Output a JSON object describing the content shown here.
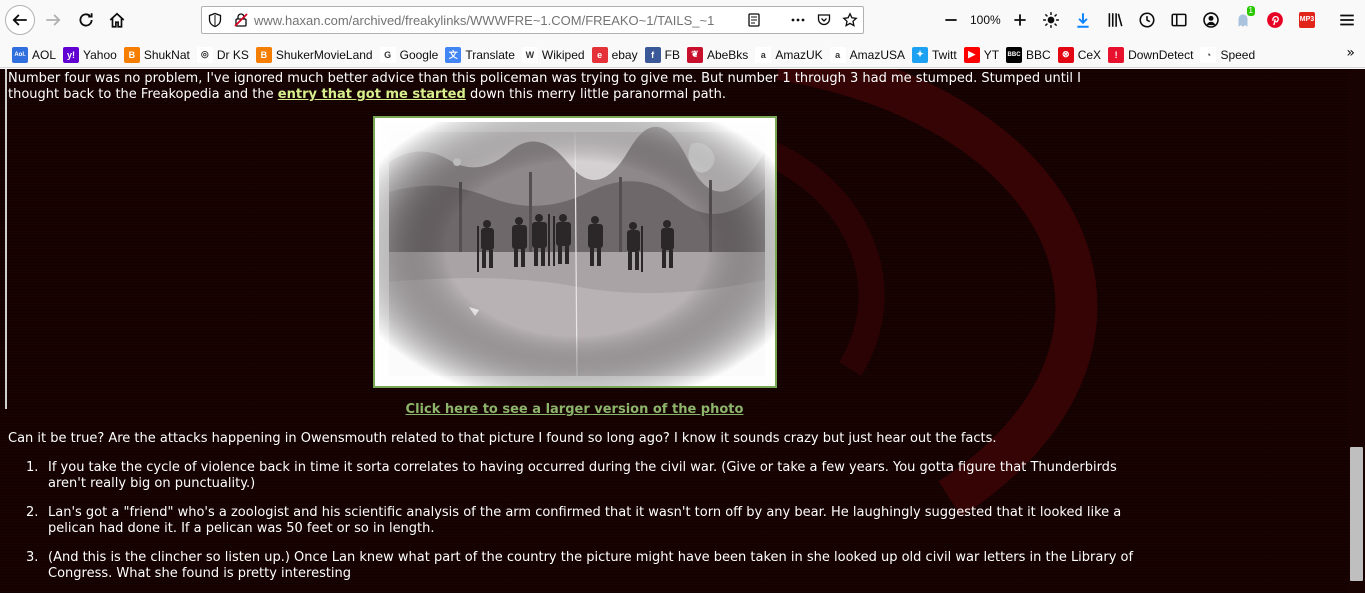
{
  "browser": {
    "url": "www.haxan.com/archived/freakylinks/WWWFRE~1.COM/FREAKO~1/TAILS_~1",
    "zoom_level": "100%",
    "extension_badge": "1",
    "mp3_label": "MP3"
  },
  "bookmarks": [
    {
      "label": "AOL",
      "icon": "aol-icon",
      "color": "#2f6fde",
      "glyph": "Aol."
    },
    {
      "label": "Yahoo",
      "icon": "yahoo-icon",
      "color": "#6001d2",
      "glyph": "y!"
    },
    {
      "label": "ShukNat",
      "icon": "blogger-icon",
      "color": "#f57d00",
      "glyph": "B"
    },
    {
      "label": "Dr KS",
      "icon": "globe-icon",
      "color": "#ffffff",
      "glyph": "◎"
    },
    {
      "label": "ShukerMovieLand",
      "icon": "blogger-icon",
      "color": "#f57d00",
      "glyph": "B"
    },
    {
      "label": "Google",
      "icon": "google-icon",
      "color": "#ffffff",
      "glyph": "G"
    },
    {
      "label": "Translate",
      "icon": "translate-icon",
      "color": "#4285f4",
      "glyph": "文"
    },
    {
      "label": "Wikiped",
      "icon": "wikipedia-icon",
      "color": "#ffffff",
      "glyph": "W"
    },
    {
      "label": "ebay",
      "icon": "ebay-icon",
      "color": "#e53238",
      "glyph": "e"
    },
    {
      "label": "FB",
      "icon": "facebook-icon",
      "color": "#3b5998",
      "glyph": "f"
    },
    {
      "label": "AbeBks",
      "icon": "abebooks-icon",
      "color": "#c8102e",
      "glyph": "❦"
    },
    {
      "label": "AmazUK",
      "icon": "amazon-icon",
      "color": "#ffffff",
      "glyph": "a"
    },
    {
      "label": "AmazUSA",
      "icon": "amazon-icon",
      "color": "#ffffff",
      "glyph": "a"
    },
    {
      "label": "Twitt",
      "icon": "twitter-icon",
      "color": "#1da1f2",
      "glyph": "✦"
    },
    {
      "label": "YT",
      "icon": "youtube-icon",
      "color": "#ff0000",
      "glyph": "▶"
    },
    {
      "label": "BBC",
      "icon": "bbc-icon",
      "color": "#000000",
      "glyph": "BBC"
    },
    {
      "label": "CeX",
      "icon": "cex-icon",
      "color": "#e30613",
      "glyph": "⊗"
    },
    {
      "label": "DownDetect",
      "icon": "downdetector-icon",
      "color": "#e8112d",
      "glyph": "!"
    },
    {
      "label": "Speed",
      "icon": "speed-icon",
      "color": "#ffffff",
      "glyph": "◔"
    }
  ],
  "page": {
    "intro_before": "Number four was no problem, I've ignored much better advice than this policeman was trying to give me. But number 1 through 3 had me stumped. Stumped until I thought back to the Freakopedia and the ",
    "intro_link": "entry that got me started",
    "intro_after": " down this merry little paranormal path.",
    "photo_link": "Click here to see a larger version of the photo",
    "question": "Can it be true? Are the attacks happening in Owensmouth related to that picture I found so long ago? I know it sounds crazy but just hear out the facts.",
    "facts": [
      {
        "num": "1.",
        "text": "If you take the cycle of violence back in time it sorta correlates to having occurred during the civil war. (Give or take a few years. You gotta figure that Thunderbirds aren't really big on punctuality.)"
      },
      {
        "num": "2.",
        "text": "Lan's got a \"friend\" who's a zoologist and his scientific analysis of the arm confirmed that it wasn't torn off by any bear. He laughingly suggested that it looked like a pelican had done it. If a pelican was 50 feet or so in length."
      },
      {
        "num": "3.",
        "text": "(And this is the clincher so listen up.) Once Lan knew what part of the country the picture might have been taken in she looked up old civil war letters in the Library of Congress. What she found is pretty interesting"
      }
    ]
  },
  "colors": {
    "page_background": "#180202",
    "link_intro": "#d7f08c",
    "link_photo": "#8db46b",
    "photo_border": "#79a756"
  }
}
